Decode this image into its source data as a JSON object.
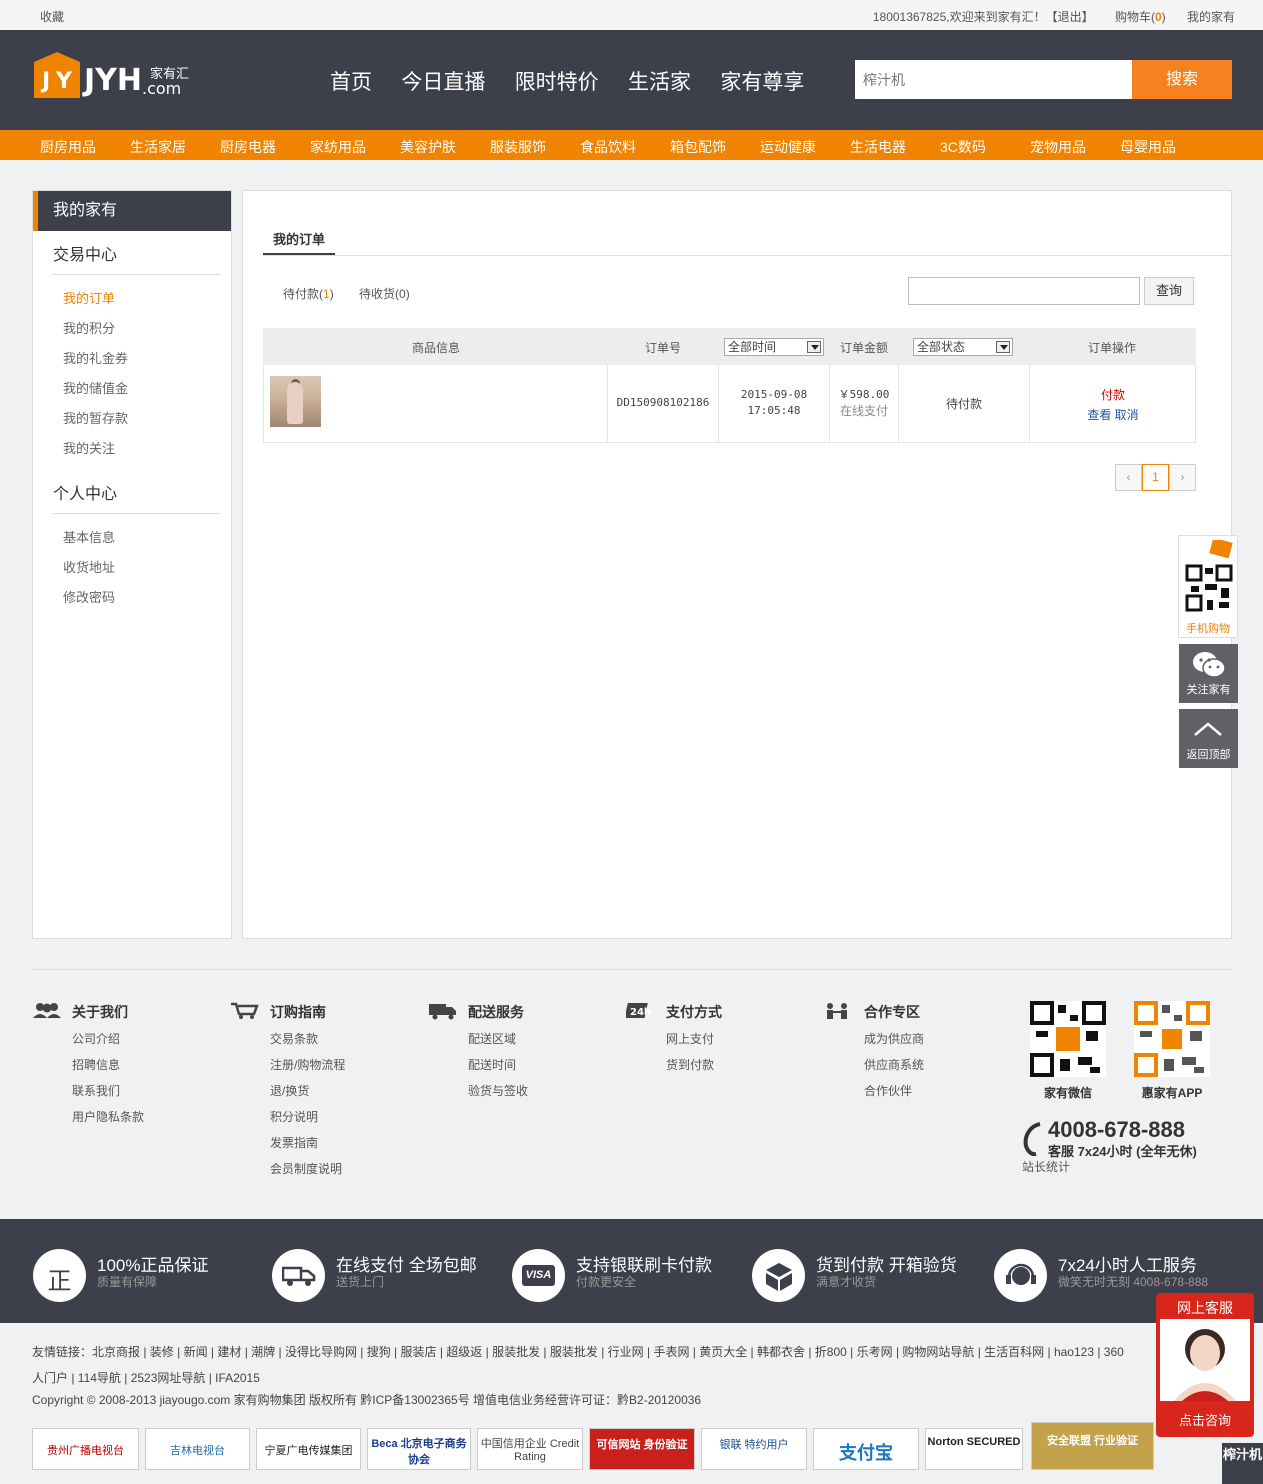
{
  "topbar": {
    "favorite": "收藏",
    "welcome": "18001367825,欢迎来到家有汇！",
    "logout": "【退出】",
    "cart_label": "购物车(",
    "cart_count": "0",
    "cart_close": ")",
    "my_jyh": "我的家有"
  },
  "header": {
    "logo_text": "JYH",
    "logo_cn": "家有汇",
    "logo_com": ".com",
    "nav": [
      "首页",
      "今日直播",
      "限时特价",
      "生活家",
      "家有尊享"
    ],
    "search_placeholder": "榨汁机",
    "search_button": "搜索"
  },
  "categories": [
    "厨房用品",
    "生活家居",
    "厨房电器",
    "家纺用品",
    "美容护肤",
    "服装服饰",
    "食品饮料",
    "箱包配饰",
    "运动健康",
    "生活电器",
    "3C数码",
    "宠物用品",
    "母婴用品"
  ],
  "sidebar": {
    "title": "我的家有",
    "section1": "交易中心",
    "items1": [
      "我的订单",
      "我的积分",
      "我的礼金券",
      "我的储值金",
      "我的暂存款",
      "我的关注"
    ],
    "section2": "个人中心",
    "items2": [
      "基本信息",
      "收货地址",
      "修改密码"
    ]
  },
  "orders": {
    "tab": "我的订单",
    "filter_pending_pay": "待付款",
    "filter_pending_pay_count": "1",
    "filter_pending_recv": "待收货",
    "filter_pending_recv_count": "0",
    "query_button": "查询",
    "columns": {
      "goods": "商品信息",
      "order_no": "订单号",
      "time_select": "全部时间",
      "amount": "订单金额",
      "status_select": "全部状态",
      "ops": "订单操作"
    },
    "row": {
      "order_no": "DD150908102186",
      "date": "2015-09-08",
      "time": "17:05:48",
      "amount": "￥598.00",
      "pay_method": "在线支付",
      "status": "待付款",
      "pay": "付款",
      "view": "查看",
      "cancel": "取消"
    },
    "pager": {
      "prev": "‹",
      "current": "1",
      "next": "›"
    }
  },
  "float": {
    "mobile": "手机购物",
    "follow": "关注家有",
    "top": "返回顶部"
  },
  "footer": {
    "cols": [
      {
        "title": "关于我们",
        "links": [
          "公司介绍",
          "招聘信息",
          "联系我们",
          "用户隐私条款"
        ]
      },
      {
        "title": "订购指南",
        "links": [
          "交易条款",
          "注册/购物流程",
          "退/换货",
          "积分说明",
          "发票指南",
          "会员制度说明"
        ]
      },
      {
        "title": "配送服务",
        "links": [
          "配送区域",
          "配送时间",
          "验货与签收"
        ]
      },
      {
        "title": "支付方式",
        "links": [
          "网上支付",
          "货到付款"
        ]
      },
      {
        "title": "合作专区",
        "links": [
          "成为供应商",
          "供应商系统",
          "合作伙伴"
        ]
      }
    ],
    "icon_24h": "24h",
    "qr1": "家有微信",
    "qr2": "惠家有APP",
    "hotline": "4008-678-888",
    "hotline_sub": "客服 7x24小时 (全年无休)",
    "stats": "站长统计"
  },
  "services": [
    {
      "title": "100%正品保证",
      "sub": "质量有保障",
      "icon": "正"
    },
    {
      "title": "在线支付 全场包邮",
      "sub": "送货上门",
      "icon": "truck-icon"
    },
    {
      "title": "支持银联刷卡付款",
      "sub": "付款更安全",
      "icon": "VISA"
    },
    {
      "title": "货到付款 开箱验货",
      "sub": "满意才收货",
      "icon": "box-icon"
    },
    {
      "title": "7x24小时人工服务",
      "sub": "微笑无时无刻 4008-678-888",
      "icon": "headset-icon"
    }
  ],
  "friends": {
    "label": "友情链接：",
    "links": "北京商报 | 装修 | 新闻 | 建材 | 潮牌 | 没得比导购网 | 搜狗 | 服装店 | 超级返 | 服装批发 | 服装批发 | 行业网 | 手表网 | 黄页大全 | 韩都衣舍 | 折800 | 乐考网 | 购物网站导航 | 生活百科网 | hao123 | 360",
    "links2": "人门户 | 114导航 | 2523网址导航 | IFA2015"
  },
  "copyright": "Copyright © 2008-2013 jiayougo.com 家有购物集团 版权所有 黔ICP备13002365号 增值电信业务经营许可证：黔B2-20120036",
  "badges": [
    "贵州广播电视台",
    "吉林电视台",
    "宁夏广电传媒集团",
    "Beca 北京电子商务协会",
    "中国信用企业 Credit Rating",
    "可信网站 身份验证",
    "银联 特约用户",
    "支付宝",
    "Norton SECURED",
    "安全联盟 行业验证"
  ],
  "kefu": {
    "title": "网上客服",
    "button": "点击咨询"
  },
  "juice": "榨汁机"
}
